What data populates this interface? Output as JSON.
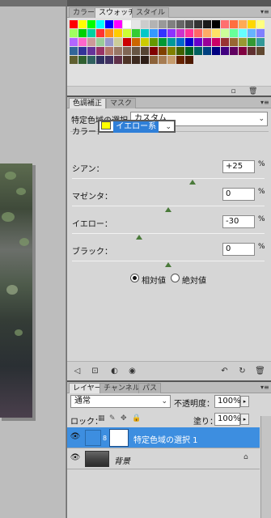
{
  "swatches": {
    "tabs": [
      "カラー",
      "スウォッチ",
      "スタイル"
    ],
    "active_tab": "スウォッチ",
    "colors": [
      "#ff0000",
      "#ffff00",
      "#00ff00",
      "#00ffff",
      "#0000ff",
      "#ff00ff",
      "#ffffff",
      "#e6e6e6",
      "#cccccc",
      "#b3b3b3",
      "#999999",
      "#808080",
      "#666666",
      "#4d4d4d",
      "#333333",
      "#1a1a1a",
      "#000000",
      "#ff6f6f",
      "#ff6f3f",
      "#ffaa55",
      "#ffd700",
      "#ffff80",
      "#a0ff60",
      "#00d000",
      "#00d0a0",
      "#ff3333",
      "#ff8c1a",
      "#ffcc00",
      "#ccff33",
      "#33cc33",
      "#00c8c8",
      "#3399ff",
      "#3333ff",
      "#8c33ff",
      "#cc33cc",
      "#ff3399",
      "#ff6666",
      "#ffaa66",
      "#ffe066",
      "#ccff99",
      "#66ff99",
      "#66ffff",
      "#66b3ff",
      "#8080ff",
      "#b366ff",
      "#ff66cc",
      "#cc9999",
      "#99cc99",
      "#9999cc",
      "#cccc99",
      "#cc0000",
      "#cc6600",
      "#cccc00",
      "#669900",
      "#009933",
      "#009999",
      "#0066cc",
      "#0000cc",
      "#6600cc",
      "#990099",
      "#cc0066",
      "#993333",
      "#996633",
      "#999933",
      "#339933",
      "#339999",
      "#336699",
      "#333399",
      "#663399",
      "#993366",
      "#b37766",
      "#997766",
      "#806655",
      "#665544",
      "#554433",
      "#800000",
      "#804000",
      "#808000",
      "#406000",
      "#006020",
      "#006060",
      "#004080",
      "#000080",
      "#400080",
      "#600060",
      "#800040",
      "#603030",
      "#604830",
      "#606030",
      "#306030",
      "#306060",
      "#303060",
      "#403060",
      "#603048",
      "#4d3326",
      "#3d2a1f",
      "#2e1f17",
      "#8c6239",
      "#a67c52",
      "#c69c6d",
      "#662200",
      "#4d1a00"
    ],
    "panel_menu_icon": "panel-menu-icon",
    "footer_icons": [
      "new-swatch-icon",
      "trash-icon"
    ]
  },
  "adjustments": {
    "tabs": [
      "色調補正",
      "マスク"
    ],
    "active_tab": "色調補正",
    "title": "特定色域の選択",
    "preset": "カスタム",
    "color_label": "カラー：",
    "color_value": "イエロー系",
    "color_swatch": "#ffff00",
    "sliders": [
      {
        "label": "シアン：",
        "value": "+25",
        "level": 0.625
      },
      {
        "label": "マゼンタ：",
        "value": "0",
        "level": 0.5
      },
      {
        "label": "イエロー：",
        "value": "-30",
        "level": 0.35
      },
      {
        "label": "ブラック：",
        "value": "0",
        "level": 0.5
      }
    ],
    "percent": "%",
    "method_relative": "相対値",
    "method_absolute": "絶対値",
    "method_selected": "相対値",
    "footer_icons": [
      "back-icon",
      "clip-icon",
      "mask-visibility-icon",
      "eye-icon",
      "previous-state-icon",
      "reset-icon",
      "trash-icon"
    ]
  },
  "layers": {
    "tabs": [
      "レイヤー",
      "チャンネル",
      "パス"
    ],
    "active_tab": "レイヤー",
    "blend_mode": "通常",
    "opacity_label": "不透明度：",
    "opacity_value": "100%",
    "lock_label": "ロック：",
    "fill_label": "塗り：",
    "fill_value": "100%",
    "items": [
      {
        "name": "特定色域の選択 1",
        "selected": true
      },
      {
        "name": "背景",
        "selected": false
      }
    ]
  }
}
